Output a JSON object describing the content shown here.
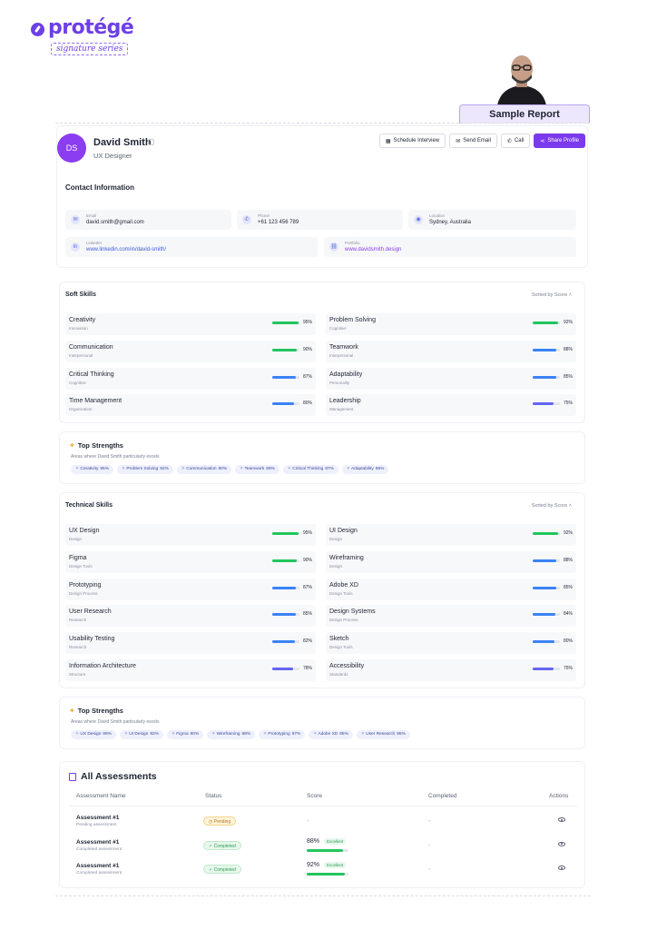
{
  "brand": {
    "name": "protégé",
    "series": "signature series"
  },
  "tab": {
    "label": "Sample Report"
  },
  "profile": {
    "initials": "DS",
    "name": "David Smith",
    "role": "UX Designer",
    "buttons": {
      "schedule": "Schedule Interview",
      "email": "Send Email",
      "call": "Call",
      "share": "Share Profile"
    }
  },
  "contact": {
    "title": "Contact Information",
    "items": [
      {
        "label": "Email",
        "value": "david.smith@gmail.com",
        "icon": "mail-icon"
      },
      {
        "label": "Phone",
        "value": "+61 123 456 789",
        "icon": "phone-icon"
      },
      {
        "label": "Location",
        "value": "Sydney, Australia",
        "icon": "location-icon"
      },
      {
        "label": "LinkedIn",
        "value": "www.linkedin.com/in/david-smith/",
        "icon": "linkedin-icon"
      },
      {
        "label": "Portfolio",
        "value": "www.davidsmith.design",
        "icon": "link-icon"
      }
    ]
  },
  "soft_skills": {
    "title": "Soft Skills",
    "sort_label": "Sorted by Score",
    "items": [
      {
        "name": "Creativity",
        "category": "Innovation",
        "pct": "95%",
        "value": 95,
        "color": "#22c55e"
      },
      {
        "name": "Problem Solving",
        "category": "Cognitive",
        "pct": "92%",
        "value": 92,
        "color": "#22c55e"
      },
      {
        "name": "Communication",
        "category": "Interpersonal",
        "pct": "90%",
        "value": 90,
        "color": "#22c55e"
      },
      {
        "name": "Teamwork",
        "category": "Interpersonal",
        "pct": "88%",
        "value": 88,
        "color": "#3b82f6"
      },
      {
        "name": "Critical Thinking",
        "category": "Cognitive",
        "pct": "87%",
        "value": 87,
        "color": "#3b82f6"
      },
      {
        "name": "Adaptability",
        "category": "Personality",
        "pct": "85%",
        "value": 85,
        "color": "#3b82f6"
      },
      {
        "name": "Time Management",
        "category": "Organization",
        "pct": "80%",
        "value": 80,
        "color": "#3b82f6"
      },
      {
        "name": "Leadership",
        "category": "Management",
        "pct": "75%",
        "value": 75,
        "color": "#6366f1"
      }
    ]
  },
  "soft_strengths": {
    "title": "Top Strengths",
    "subtitle": "Areas where David Smith particularly excels",
    "chips": [
      {
        "label": "Creativity",
        "pct": "95%"
      },
      {
        "label": "Problem Solving",
        "pct": "92%"
      },
      {
        "label": "Communication",
        "pct": "90%"
      },
      {
        "label": "Teamwork",
        "pct": "88%"
      },
      {
        "label": "Critical Thinking",
        "pct": "87%"
      },
      {
        "label": "Adaptability",
        "pct": "85%"
      }
    ]
  },
  "tech_skills": {
    "title": "Technical Skills",
    "sort_label": "Sorted by Score",
    "items": [
      {
        "name": "UX Design",
        "category": "Design",
        "pct": "95%",
        "value": 95,
        "color": "#22c55e"
      },
      {
        "name": "UI Design",
        "category": "Design",
        "pct": "92%",
        "value": 92,
        "color": "#22c55e"
      },
      {
        "name": "Figma",
        "category": "Design Tools",
        "pct": "90%",
        "value": 90,
        "color": "#22c55e"
      },
      {
        "name": "Wireframing",
        "category": "Design",
        "pct": "88%",
        "value": 88,
        "color": "#3b82f6"
      },
      {
        "name": "Prototyping",
        "category": "Design Process",
        "pct": "87%",
        "value": 87,
        "color": "#3b82f6"
      },
      {
        "name": "Adobe XD",
        "category": "Design Tools",
        "pct": "85%",
        "value": 85,
        "color": "#3b82f6"
      },
      {
        "name": "User Research",
        "category": "Research",
        "pct": "85%",
        "value": 85,
        "color": "#3b82f6"
      },
      {
        "name": "Design Systems",
        "category": "Design Process",
        "pct": "84%",
        "value": 84,
        "color": "#3b82f6"
      },
      {
        "name": "Usability Testing",
        "category": "Research",
        "pct": "82%",
        "value": 82,
        "color": "#3b82f6"
      },
      {
        "name": "Sketch",
        "category": "Design Tools",
        "pct": "80%",
        "value": 80,
        "color": "#3b82f6"
      },
      {
        "name": "Information Architecture",
        "category": "Structure",
        "pct": "78%",
        "value": 78,
        "color": "#6366f1"
      },
      {
        "name": "Accessibility",
        "category": "Standards",
        "pct": "75%",
        "value": 75,
        "color": "#6366f1"
      }
    ]
  },
  "tech_strengths": {
    "title": "Top Strengths",
    "subtitle": "Areas where David Smith particularly excels",
    "chips": [
      {
        "label": "UX Design",
        "pct": "95%"
      },
      {
        "label": "UI Design",
        "pct": "92%"
      },
      {
        "label": "Figma",
        "pct": "90%"
      },
      {
        "label": "Wireframing",
        "pct": "88%"
      },
      {
        "label": "Prototyping",
        "pct": "87%"
      },
      {
        "label": "Adobe XD",
        "pct": "85%"
      },
      {
        "label": "User Research",
        "pct": "85%"
      }
    ]
  },
  "assessments": {
    "title": "All Assessments",
    "columns": [
      "Assessment Name",
      "Status",
      "Score",
      "Completed",
      "Actions"
    ],
    "rows": [
      {
        "name": "Assessment #1",
        "sub": "Pending assessment",
        "status": "Pending",
        "status_kind": "pending",
        "score": "-",
        "score_value": null,
        "score_tag": "",
        "completed": "-"
      },
      {
        "name": "Assessment #1",
        "sub": "Completed assessment",
        "status": "Completed",
        "status_kind": "done",
        "score": "88%",
        "score_value": 88,
        "score_tag": "Excellent",
        "completed": "-"
      },
      {
        "name": "Assessment #1",
        "sub": "Completed assessment",
        "status": "Completed",
        "status_kind": "done",
        "score": "92%",
        "score_value": 92,
        "score_tag": "Excellent",
        "completed": "-"
      }
    ]
  }
}
